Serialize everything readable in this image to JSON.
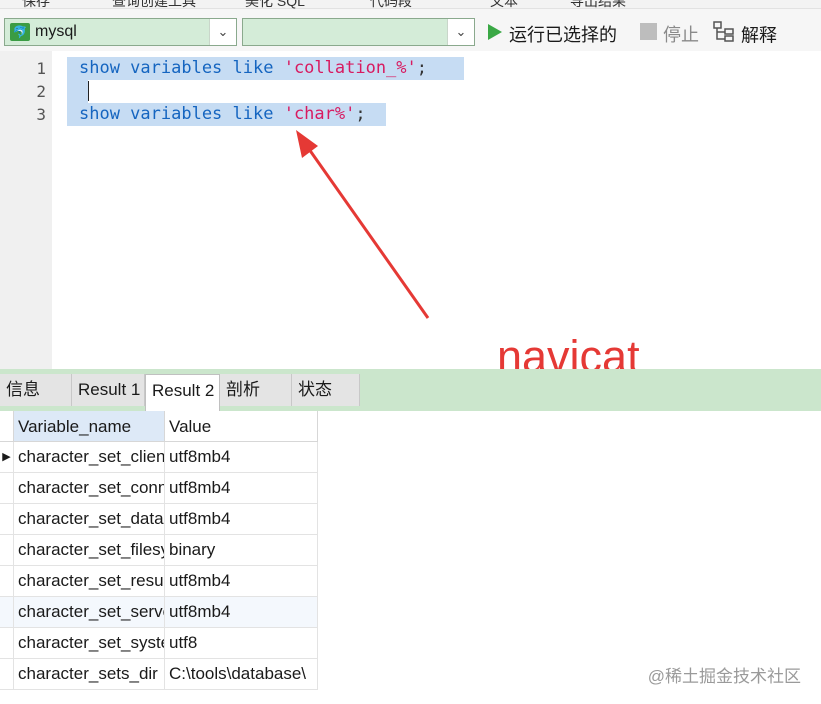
{
  "toolbar_top": {
    "fragments": [
      "保存",
      "查询创建工具",
      "美化 SQL",
      "代码段",
      "文本",
      "导出结果"
    ]
  },
  "toolbar": {
    "connection": {
      "value": "mysql",
      "icon": "mysql-connection-icon"
    },
    "database": {
      "value": ""
    },
    "run_selected_label": "运行已选择的",
    "stop_label": "停止",
    "explain_label": "解释",
    "colors": {
      "combo_bg": "#d4ecd8",
      "run_icon": "#3aa845"
    }
  },
  "editor": {
    "line_numbers": [
      "1",
      "2",
      "3"
    ],
    "lines": [
      {
        "kw": "show variables like ",
        "str": "'collation_%'",
        "end": ";"
      },
      {
        "kw": "",
        "str": "",
        "end": ""
      },
      {
        "kw": "show variables like ",
        "str": "'char%'",
        "end": ";"
      }
    ],
    "selection_color": "#c6dcf3"
  },
  "annotation": {
    "label": "navicat",
    "color": "#e53935"
  },
  "result_tabs": [
    {
      "label": "信息",
      "active": false
    },
    {
      "label": "Result 1",
      "active": false
    },
    {
      "label": "Result 2",
      "active": true
    },
    {
      "label": "剖析",
      "active": false
    },
    {
      "label": "状态",
      "active": false
    }
  ],
  "grid": {
    "columns": [
      "Variable_name",
      "Value"
    ],
    "rows": [
      [
        "character_set_client",
        "utf8mb4"
      ],
      [
        "character_set_connection",
        "utf8mb4"
      ],
      [
        "character_set_database",
        "utf8mb4"
      ],
      [
        "character_set_filesystem",
        "binary"
      ],
      [
        "character_set_results",
        "utf8mb4"
      ],
      [
        "character_set_server",
        "utf8mb4"
      ],
      [
        "character_set_system",
        "utf8"
      ],
      [
        "character_sets_dir",
        "C:\\tools\\database\\"
      ]
    ]
  },
  "watermark": "@稀土掘金技术社区"
}
